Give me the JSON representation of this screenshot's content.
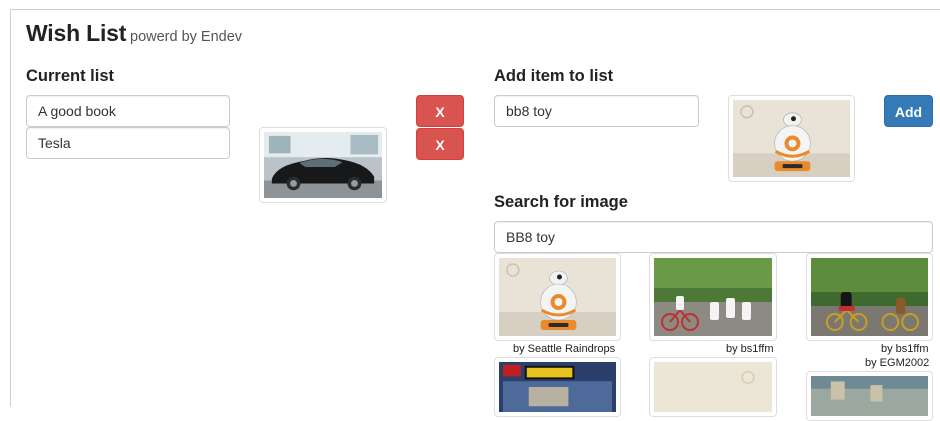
{
  "header": {
    "title": "Wish List",
    "subtitle": "powerd by Endev"
  },
  "current_list": {
    "heading": "Current list",
    "items": [
      {
        "text": "A good book",
        "remove_label": "X"
      },
      {
        "text": "Tesla",
        "remove_label": "X"
      }
    ]
  },
  "add_item": {
    "heading": "Add item to list",
    "input_value": "bb8 toy",
    "add_label": "Add"
  },
  "search": {
    "heading": "Search for image",
    "input_value": "BB8 toy",
    "results": [
      {
        "credit": "by Seattle Raindrops"
      },
      {
        "credit": "by bs1ffm"
      },
      {
        "credit": "by bs1ffm"
      },
      {
        "credit": "by EGM2002"
      }
    ]
  },
  "colors": {
    "danger": "#d9534f",
    "primary": "#337ab7"
  }
}
